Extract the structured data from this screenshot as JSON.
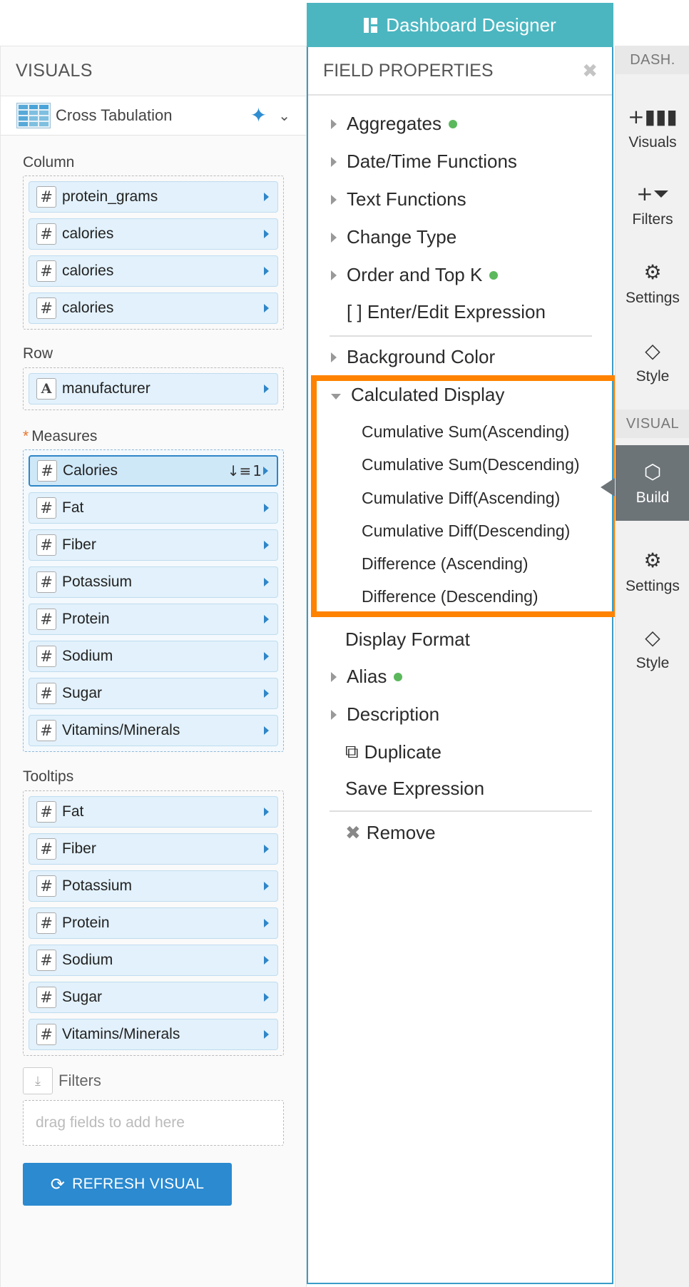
{
  "designer": {
    "title": "Dashboard Designer",
    "icon": "dashboard-icon"
  },
  "visuals_panel": {
    "title": "VISUALS",
    "visual_type": "Cross Tabulation",
    "column": {
      "label": "Column",
      "fields": [
        {
          "name": "protein_grams",
          "type": "#"
        },
        {
          "name": "calories",
          "type": "#"
        },
        {
          "name": "calories",
          "type": "#"
        },
        {
          "name": "calories",
          "type": "#"
        }
      ]
    },
    "row": {
      "label": "Row",
      "fields": [
        {
          "name": "manufacturer",
          "type": "A"
        }
      ]
    },
    "measures": {
      "label": "Measures",
      "required_mark": "*",
      "fields": [
        {
          "name": "Calories",
          "type": "#",
          "selected": true,
          "sort_badge": "1"
        },
        {
          "name": "Fat",
          "type": "#"
        },
        {
          "name": "Fiber",
          "type": "#"
        },
        {
          "name": "Potassium",
          "type": "#"
        },
        {
          "name": "Protein",
          "type": "#"
        },
        {
          "name": "Sodium",
          "type": "#"
        },
        {
          "name": "Sugar",
          "type": "#"
        },
        {
          "name": "Vitamins/Minerals",
          "type": "#"
        }
      ]
    },
    "tooltips": {
      "label": "Tooltips",
      "fields": [
        {
          "name": "Fat",
          "type": "#"
        },
        {
          "name": "Fiber",
          "type": "#"
        },
        {
          "name": "Potassium",
          "type": "#"
        },
        {
          "name": "Protein",
          "type": "#"
        },
        {
          "name": "Sodium",
          "type": "#"
        },
        {
          "name": "Sugar",
          "type": "#"
        },
        {
          "name": "Vitamins/Minerals",
          "type": "#"
        }
      ]
    },
    "filters": {
      "label": "Filters",
      "placeholder": "drag fields to add here"
    },
    "refresh_button": "REFRESH VISUAL"
  },
  "field_properties": {
    "title": "FIELD PROPERTIES",
    "close_icon": "close-icon",
    "items": {
      "aggregates": "Aggregates",
      "datetime": "Date/Time Functions",
      "text": "Text Functions",
      "change_type": "Change Type",
      "order_topk": "Order and Top K",
      "expression": "[ ] Enter/Edit Expression",
      "background_color": "Background Color",
      "calculated_display": "Calculated Display",
      "display_format": "Display Format",
      "alias": "Alias",
      "description": "Description",
      "duplicate": "Duplicate",
      "save_expression": "Save Expression",
      "remove": "Remove"
    },
    "calculated_display_options": [
      "Cumulative Sum(Ascending)",
      "Cumulative Sum(Descending)",
      "Cumulative Diff(Ascending)",
      "Cumulative Diff(Descending)",
      "Difference (Ascending)",
      "Difference (Descending)"
    ],
    "status_dot_color": "#5cb85c",
    "highlight_color": "#ff8200"
  },
  "rail": {
    "dash_label": "DASH.",
    "visual_label": "VISUAL",
    "dash_items": [
      "Visuals",
      "Filters",
      "Settings",
      "Style"
    ],
    "visual_items": [
      "Build",
      "Settings",
      "Style"
    ],
    "active": "Build"
  },
  "colors": {
    "accent": "#4bb6c0",
    "primary_button": "#2b8ad0",
    "active_rail": "#6d7478"
  }
}
